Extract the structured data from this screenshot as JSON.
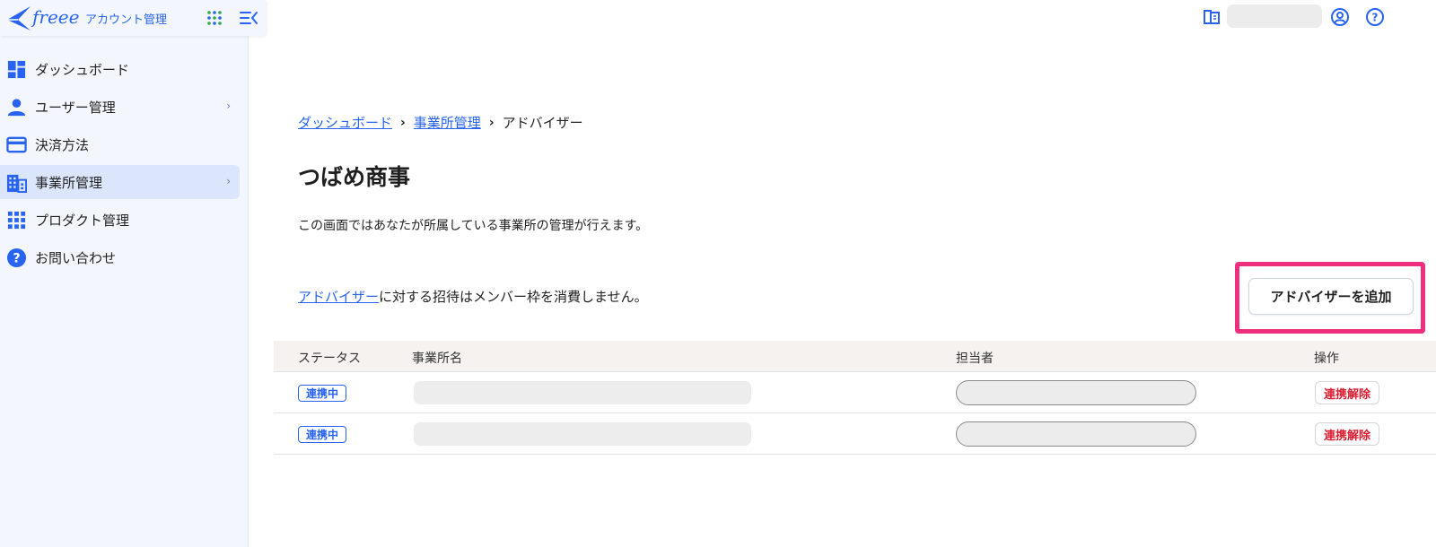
{
  "brand": {
    "wordmark": "freee",
    "product": "アカウント管理"
  },
  "sidebar": {
    "items": [
      {
        "label": "ダッシュボード",
        "icon": "dashboard-icon"
      },
      {
        "label": "ユーザー管理",
        "icon": "user-icon",
        "chevron": "›"
      },
      {
        "label": "決済方法",
        "icon": "credit-card-icon"
      },
      {
        "label": "事業所管理",
        "icon": "building-icon",
        "chevron": "›",
        "active": true
      },
      {
        "label": "プロダクト管理",
        "icon": "grid-icon"
      },
      {
        "label": "お問い合わせ",
        "icon": "help-circle-icon"
      }
    ]
  },
  "breadcrumb": {
    "items": [
      "ダッシュボード",
      "事業所管理",
      "アドバイザー"
    ],
    "separator": "›"
  },
  "page": {
    "title": "つばめ商事",
    "description": "この画面ではあなたが所属している事業所の管理が行えます。"
  },
  "notice": {
    "link": "アドバイザー",
    "text": "に対する招待はメンバー枠を消費しません。"
  },
  "add_button": "アドバイザーを追加",
  "table": {
    "headers": [
      "ステータス",
      "事業所名",
      "担当者",
      "操作"
    ],
    "rows": [
      {
        "status": "連携中",
        "action": "連携解除"
      },
      {
        "status": "連携中",
        "action": "連携解除"
      }
    ]
  },
  "colors": {
    "accent": "#2864f0",
    "danger": "#dc1e32",
    "highlight": "#ef2f7e",
    "sidebar_bg": "#f3f6fd",
    "active_bg": "#dbe6fd"
  }
}
